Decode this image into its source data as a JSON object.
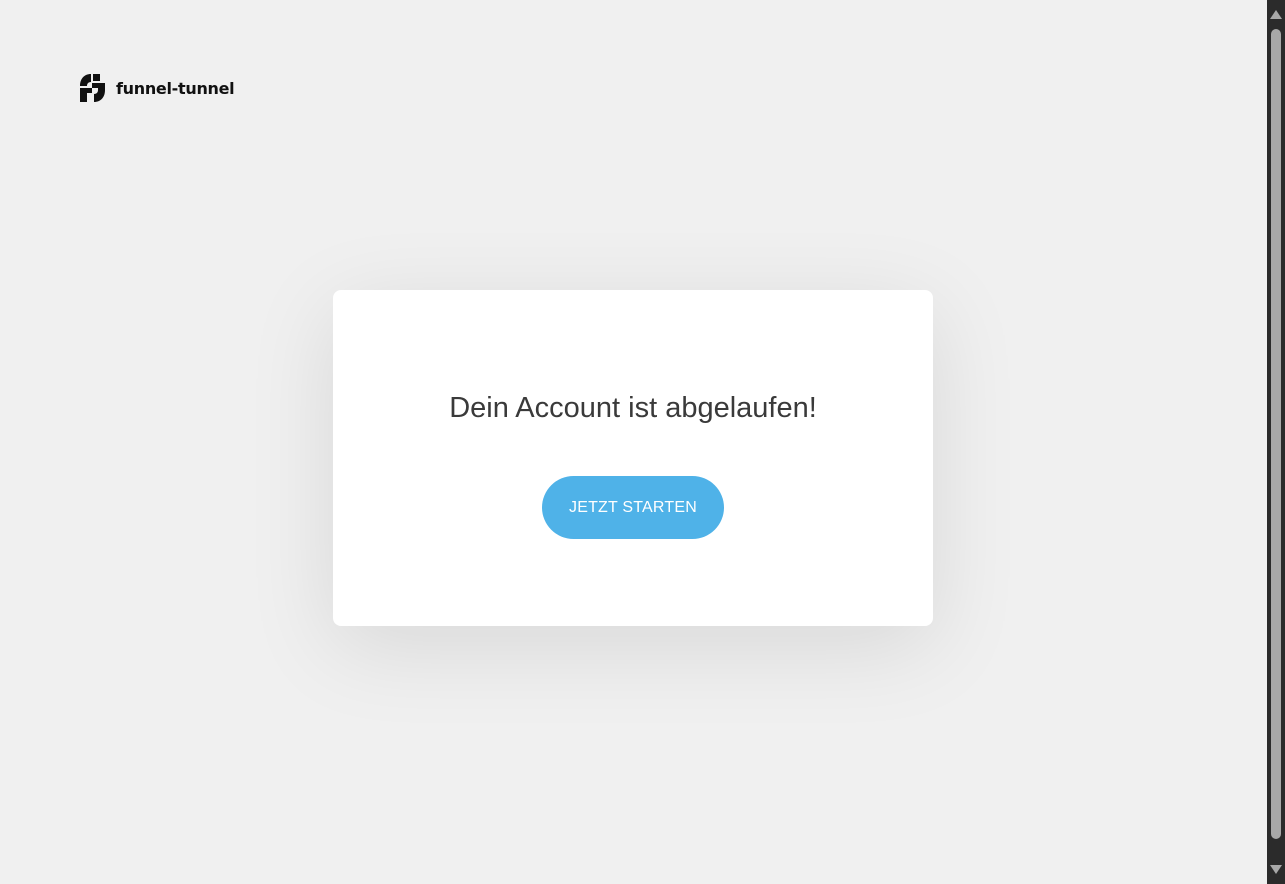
{
  "brand": {
    "name": "funnel-tunnel",
    "logo_icon": "funnel-tunnel-logo-icon"
  },
  "card": {
    "title": "Dein Account ist abgelaufen!",
    "button_label": "JETZT STARTEN"
  },
  "colors": {
    "background": "#f0f0f0",
    "card": "#ffffff",
    "button": "#4fb2e8",
    "title_text": "#3a3a3a"
  }
}
